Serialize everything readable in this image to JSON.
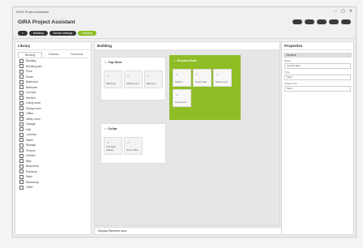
{
  "window": {
    "title": "GIRA Project Assistant",
    "controls": [
      "–",
      "▢",
      "✕"
    ]
  },
  "header": {
    "app_title": "GIRA Project Assistant",
    "right_label": "",
    "buttons": [
      "",
      "",
      "",
      "",
      ""
    ]
  },
  "toolbar": {
    "items": [
      {
        "label": "⌂",
        "active": false
      },
      {
        "label": "Building",
        "active": false
      },
      {
        "label": "Device settings",
        "active": false
      },
      {
        "label": "Building",
        "active": true
      }
    ]
  },
  "library": {
    "title": "Library",
    "tabs": [
      "Building",
      "Devices",
      "Functions"
    ],
    "items": [
      "Building",
      "Building part",
      "Floor",
      "Room",
      "Bathroom",
      "Bedroom",
      "Corridor",
      "Kitchen",
      "Living room",
      "Dining room",
      "Office",
      "Utility room",
      "Garage",
      "Hall",
      "Laundry",
      "Stairs",
      "Storage",
      "Terrace",
      "Garden",
      "Attic",
      "Basement",
      "Entrance",
      "Patio",
      "Workshop",
      "Other"
    ]
  },
  "building": {
    "title": "Building",
    "floors": [
      {
        "name": "Top floor",
        "rooms": [
          {
            "name": "Bathroom",
            "icon": "⌂"
          },
          {
            "name": "Child's room",
            "icon": "⌂"
          },
          {
            "name": "Bedroom",
            "icon": "⌂"
          }
        ]
      },
      {
        "name": "Ground floor",
        "rooms": [
          {
            "name": "Kitchen",
            "icon": "⌂"
          },
          {
            "name": "Guest toilet",
            "icon": "⌂"
          },
          {
            "name": "Dining room",
            "icon": "⌂"
          },
          {
            "name": "Living room",
            "icon": "⌂"
          }
        ]
      },
      {
        "name": "Cellar",
        "rooms": [
          {
            "name": "Technical cabinet",
            "icon": "⌂"
          },
          {
            "name": "Home office",
            "icon": "⌂"
          }
        ]
      }
    ]
  },
  "display_elements": {
    "title": "Display Elements area"
  },
  "properties": {
    "title": "Properties",
    "group": "General",
    "fields": [
      {
        "label": "Name",
        "value": "Ground floor"
      },
      {
        "label": "Type",
        "value": "Floor"
      },
      {
        "label": "Assignment",
        "value": "Floor"
      }
    ]
  }
}
